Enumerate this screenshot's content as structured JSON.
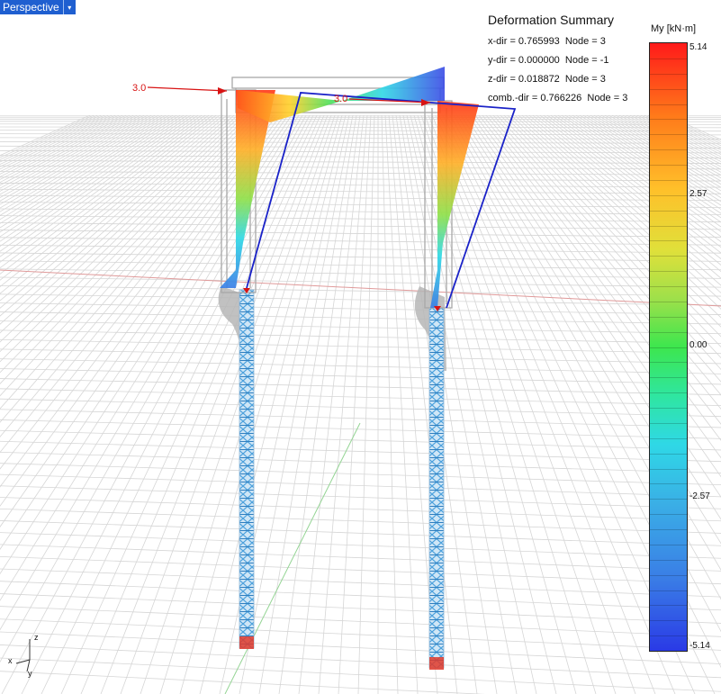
{
  "viewport": {
    "tab_label": "Perspective",
    "dropdown_glyph": "▾"
  },
  "summary": {
    "title": "Deformation Summary",
    "rows": [
      "x-dir = 0.765993  Node = 3",
      "y-dir = 0.000000  Node = -1",
      "z-dir = 0.018872  Node = 3",
      "comb.-dir = 0.766226  Node = 3"
    ]
  },
  "legend": {
    "title": "My [kN·m]",
    "ticks": [
      "5.14",
      "2.57",
      "0.00",
      "-2.57",
      "-5.14"
    ]
  },
  "loads": {
    "load_left": "3.0",
    "load_mid": "3.0"
  },
  "axes": {
    "z": "z",
    "x": "x",
    "y": "y"
  },
  "colors": {
    "tab": "#1f5fd0",
    "deformed": "#1a22c8",
    "load": "#d81414",
    "grid": "#d6d6d6",
    "axis_red": "#e08a8a",
    "axis_green": "#8fd08f"
  }
}
